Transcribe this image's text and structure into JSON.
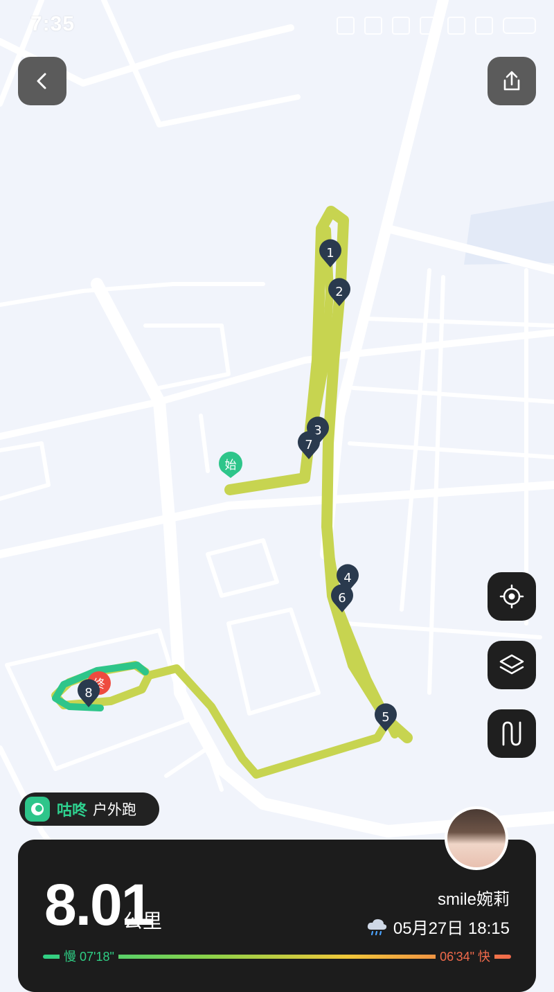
{
  "status_bar": {
    "time": "7:35"
  },
  "map": {
    "start_label": "始",
    "end_label": "终",
    "km_markers": [
      "1",
      "2",
      "3",
      "4",
      "5",
      "6",
      "7",
      "8"
    ]
  },
  "app": {
    "brand": "咕咚",
    "activity_type": "户外跑"
  },
  "summary": {
    "distance": "8.01",
    "distance_unit": "公里",
    "username": "smile婉莉",
    "datetime": "05月27日 18:15",
    "weather_icon": "rain-cloud-icon",
    "pace_slow": "慢 07'18\"",
    "pace_fast": "06'34\" 快"
  },
  "icons": {
    "back": "back-chevron-icon",
    "share": "share-icon",
    "locate": "locate-icon",
    "layers": "layers-icon",
    "route": "route-icon"
  },
  "colors": {
    "track": "#c7d450",
    "track_end": "#2ec58a",
    "marker": "#2a3a4e",
    "start_marker": "#2ec58a",
    "end_marker": "#ee4b3f",
    "card": "#1c1c1c",
    "brand_green": "#2ed18f"
  }
}
